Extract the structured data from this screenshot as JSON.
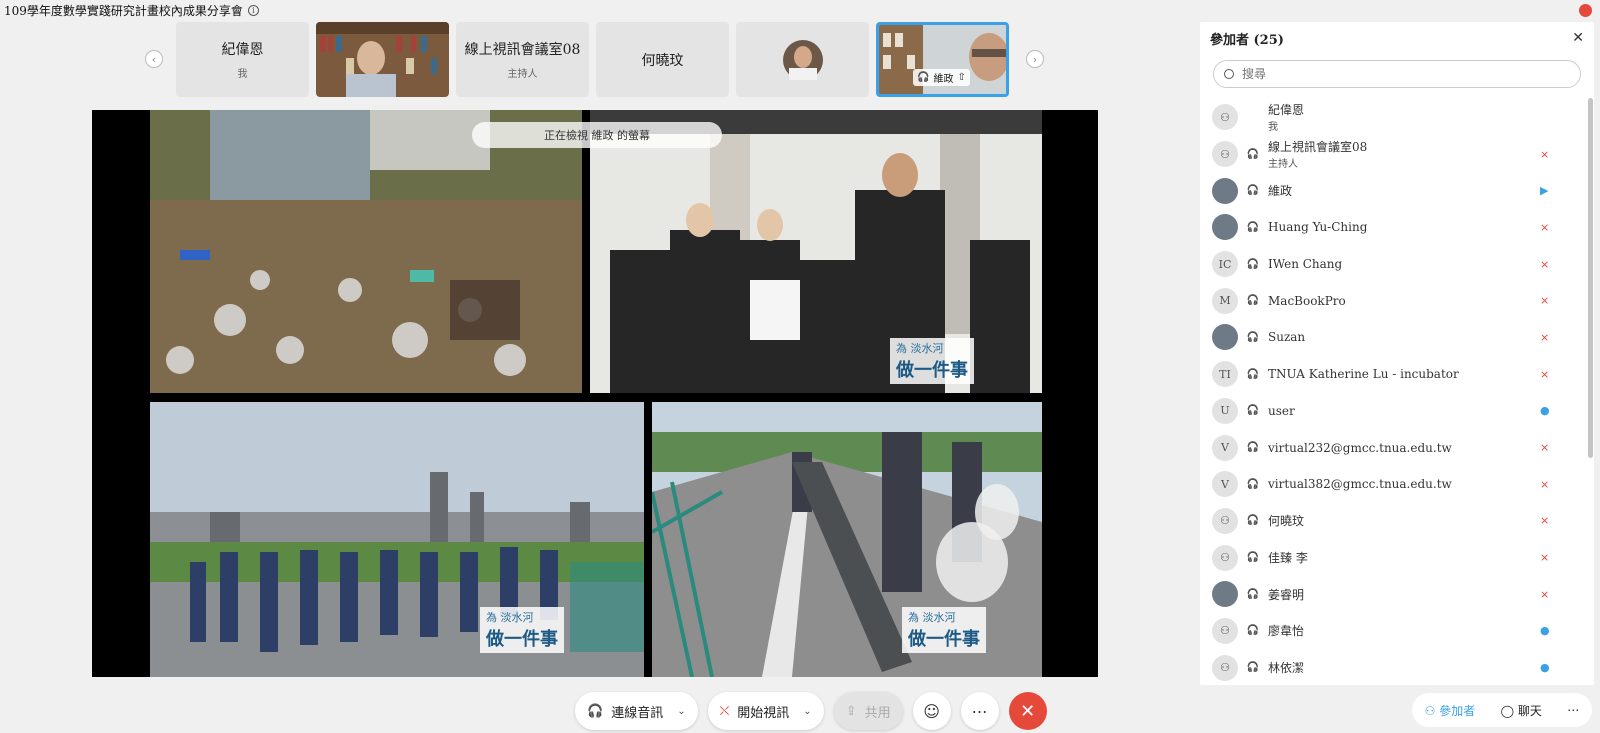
{
  "meeting": {
    "title": "109學年度數學實踐研究計畫校內成果分享會"
  },
  "thumbnails": [
    {
      "name": "紀偉恩",
      "sub": "我",
      "type": "name"
    },
    {
      "name": "",
      "sub": "",
      "type": "video"
    },
    {
      "name": "線上視訊會議室08",
      "sub": "主持人",
      "type": "name"
    },
    {
      "name": "何曉玟",
      "sub": "",
      "type": "name"
    },
    {
      "name": "",
      "sub": "",
      "type": "avatar"
    },
    {
      "name": "維政",
      "sub": "",
      "type": "video-active"
    }
  ],
  "share": {
    "banner": "正在檢視 維政 的螢幕",
    "caption_line1": "為 淡水河",
    "caption_line2": "做一件事"
  },
  "toolbar": {
    "audio_label": "連線音訊",
    "video_label": "開始視訊",
    "share_label": "共用"
  },
  "panel": {
    "title": "參加者 (25)",
    "search_placeholder": "搜尋",
    "participants": [
      {
        "name": "紀偉恩",
        "role": "我",
        "avatar": "",
        "status": ""
      },
      {
        "name": "線上視訊會議室08",
        "role": "主持人",
        "avatar": "",
        "status": "muted"
      },
      {
        "name": "維政",
        "role": "",
        "avatar": "photo",
        "status": "video"
      },
      {
        "name": "Huang Yu-Ching",
        "role": "",
        "avatar": "photo",
        "status": "muted"
      },
      {
        "name": "IWen Chang",
        "role": "",
        "avatar": "IC",
        "status": "muted"
      },
      {
        "name": "MacBookPro",
        "role": "",
        "avatar": "M",
        "status": "muted"
      },
      {
        "name": "Suzan",
        "role": "",
        "avatar": "photo",
        "status": "muted"
      },
      {
        "name": "TNUA Katherine Lu - incubator",
        "role": "",
        "avatar": "TI",
        "status": "muted"
      },
      {
        "name": "user",
        "role": "",
        "avatar": "U",
        "status": "on"
      },
      {
        "name": "virtual232@gmcc.tnua.edu.tw",
        "role": "",
        "avatar": "V",
        "status": "muted"
      },
      {
        "name": "virtual382@gmcc.tnua.edu.tw",
        "role": "",
        "avatar": "V",
        "status": "muted"
      },
      {
        "name": "何曉玟",
        "role": "",
        "avatar": "",
        "status": "muted"
      },
      {
        "name": "佳臻 李",
        "role": "",
        "avatar": "",
        "status": "muted"
      },
      {
        "name": "姜睿明",
        "role": "",
        "avatar": "photo",
        "status": "muted"
      },
      {
        "name": "廖韋怡",
        "role": "",
        "avatar": "",
        "status": "on"
      },
      {
        "name": "林依潔",
        "role": "",
        "avatar": "",
        "status": "on"
      }
    ]
  },
  "bottom_tabs": {
    "participants_label": "參加者",
    "chat_label": "聊天"
  }
}
